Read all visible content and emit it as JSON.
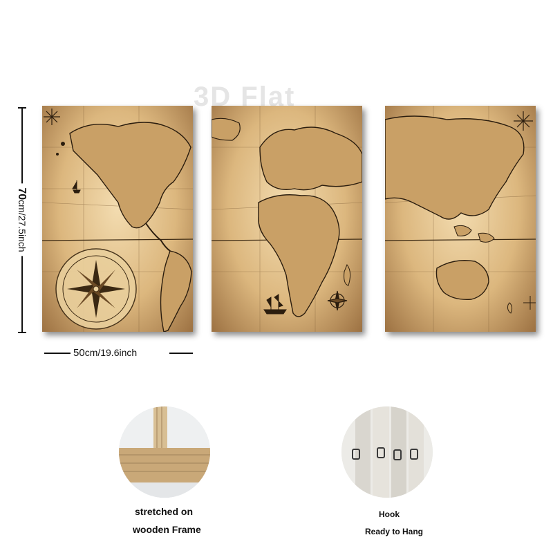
{
  "watermark": "3D Flat",
  "dimensions": {
    "height_cm": "70",
    "height_rest": "cm/27.5inch",
    "width_cm": "50",
    "width_rest": "cm/19.6inch"
  },
  "panels": [
    {
      "id": "left",
      "content": "Americas map with compass rose"
    },
    {
      "id": "center",
      "content": "Europe and Africa map with ship"
    },
    {
      "id": "right",
      "content": "Asia and Australia map"
    }
  ],
  "details": {
    "frame": {
      "line1": "stretched on",
      "line2": "wooden Frame"
    },
    "hook": {
      "line1": "Hook",
      "line2": "Ready to Hang"
    }
  },
  "colors": {
    "parchment_light": "#f3dcb0",
    "parchment_mid": "#dcb77e",
    "parchment_dark": "#9c7142",
    "ink": "#2b1d0e"
  }
}
